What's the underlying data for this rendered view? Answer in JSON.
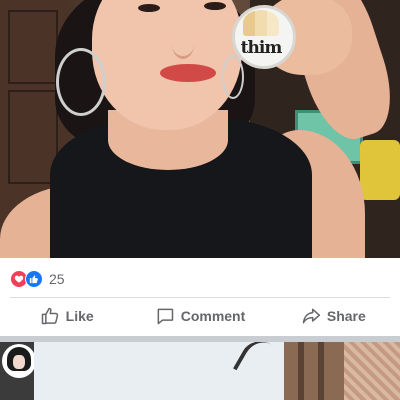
{
  "post": {
    "reactions": {
      "icons": [
        "heart-reaction-icon",
        "like-reaction-icon"
      ],
      "love_color": "#f33e58",
      "like_color": "#1877f2",
      "count": "25"
    },
    "actions": {
      "like_label": "Like",
      "comment_label": "Comment",
      "share_label": "Share"
    },
    "photo": {
      "product_text": "thim"
    }
  },
  "colors": {
    "text_secondary": "#65676b",
    "divider": "#dadde1",
    "separator": "#c9ccd1"
  }
}
